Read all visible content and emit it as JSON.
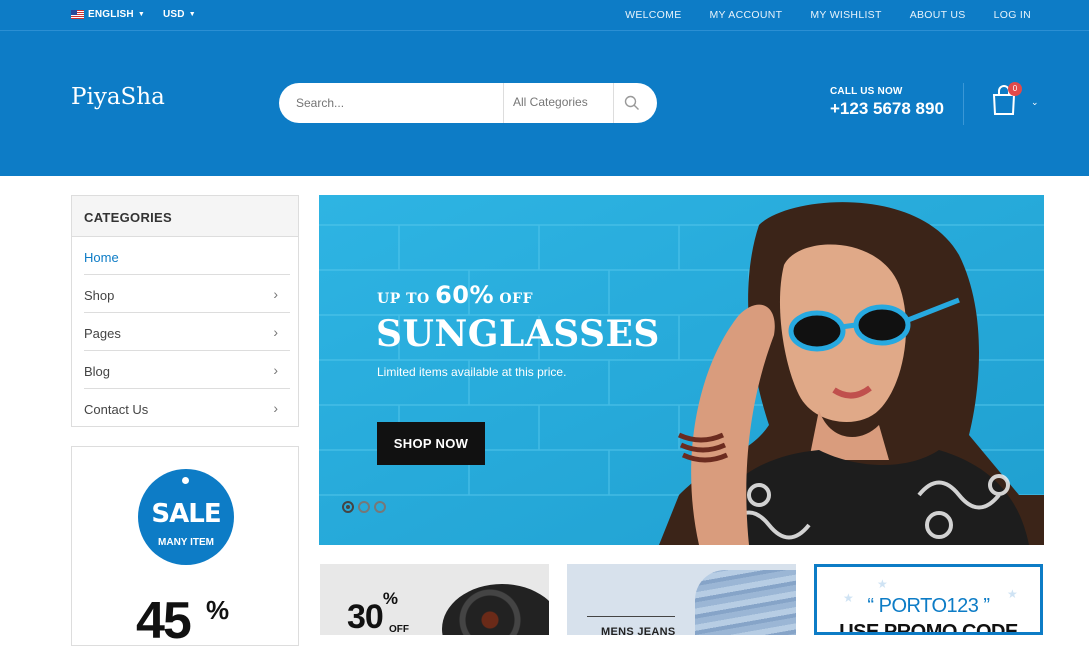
{
  "topbar": {
    "language": "ENGLISH",
    "currency": "USD",
    "links": [
      "WELCOME",
      "MY ACCOUNT",
      "MY WISHLIST",
      "ABOUT US",
      "LOG IN"
    ]
  },
  "header": {
    "logo": "PiyaSha",
    "search_placeholder": "Search...",
    "category_select": "All Categories",
    "call_label": "CALL US NOW",
    "phone": "+123 5678 890",
    "cart_count": "0"
  },
  "sidebar": {
    "title": "CATEGORIES",
    "items": [
      {
        "label": "Home"
      },
      {
        "label": "Shop"
      },
      {
        "label": "Pages"
      },
      {
        "label": "Blog"
      },
      {
        "label": "Contact Us"
      }
    ],
    "sale": {
      "title": "SALE",
      "subtitle": "MANY ITEM",
      "percent": "45",
      "percent_sign": "%"
    }
  },
  "banner": {
    "kicker_prefix": "UP TO ",
    "kicker_value": "60%",
    "kicker_suffix": " OFF",
    "title": "SUNGLASSES",
    "subtitle": "Limited items available at this price.",
    "button": "SHOP NOW",
    "slides": 3,
    "active_slide": 1
  },
  "promos": {
    "p1_percent": "30",
    "p1_sign": "%",
    "p1_off": "OFF",
    "p2_label": "MENS JEANS",
    "p3_code": "“ PORTO123 ”",
    "p3_text": "USE PROMO CODE"
  },
  "colors": {
    "brand": "#0d7cc6",
    "button": "#111111",
    "badge": "#e24a4a"
  }
}
